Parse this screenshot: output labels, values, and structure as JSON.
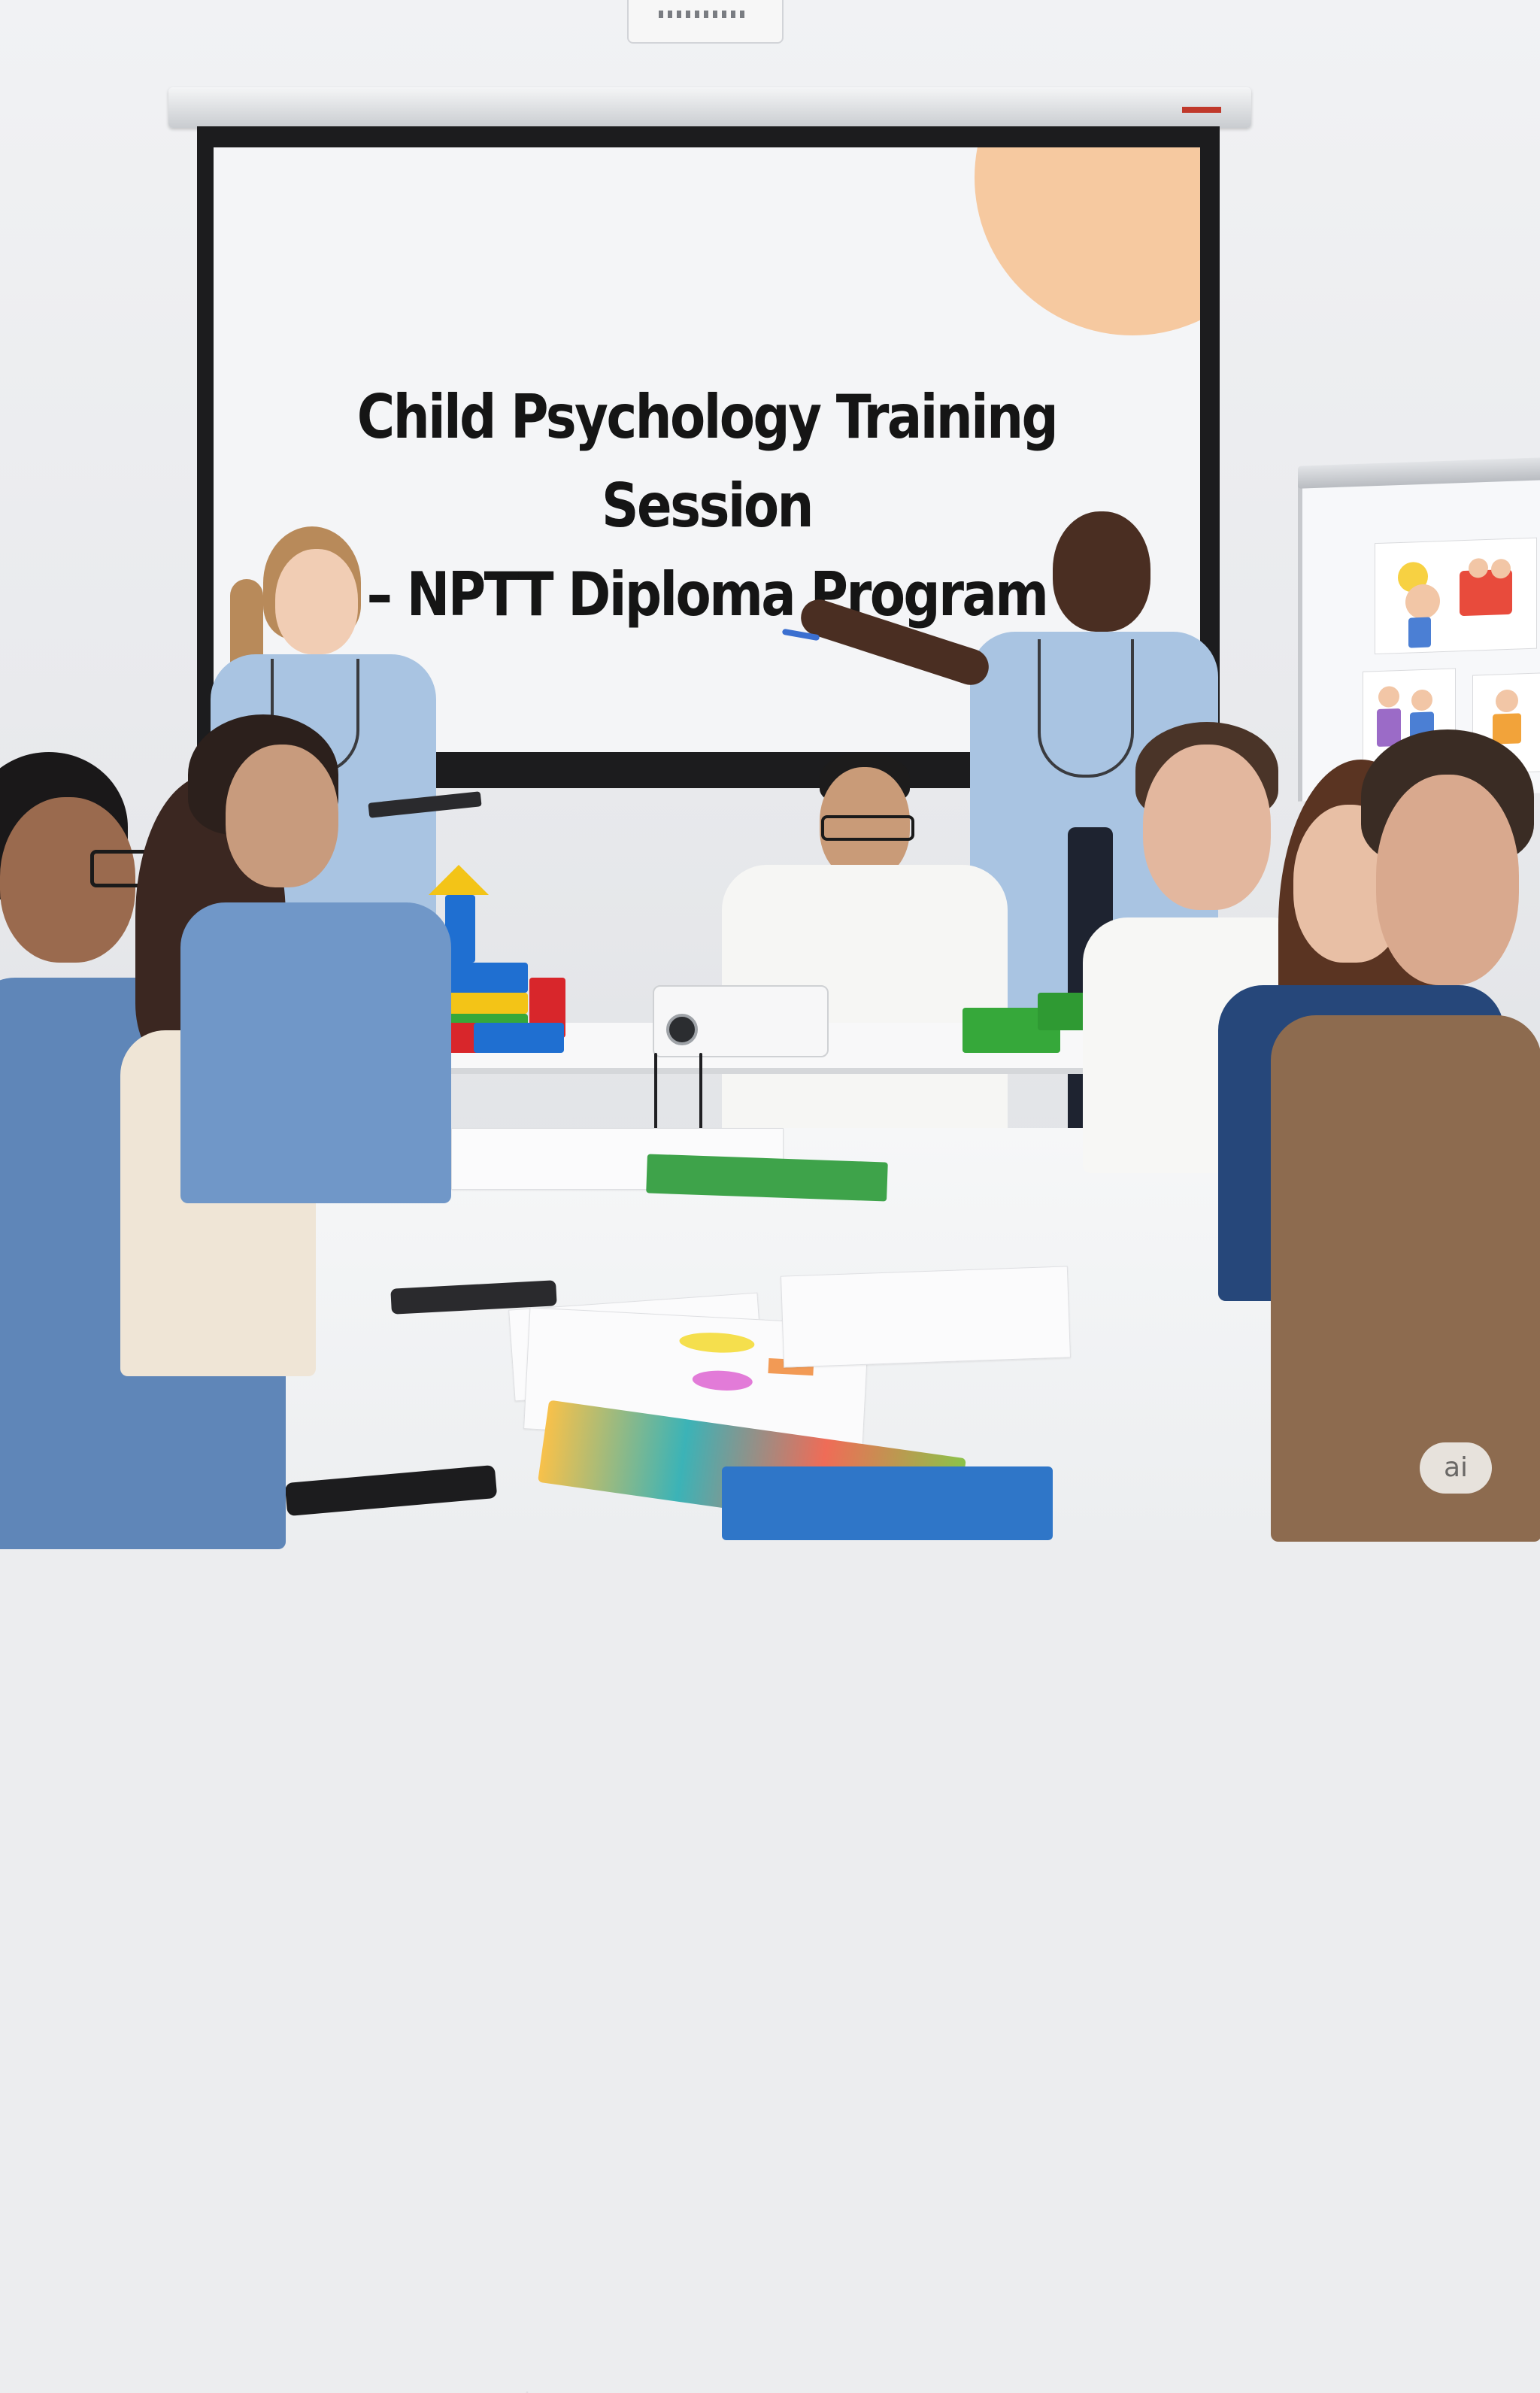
{
  "slide": {
    "title_line1": "Child Psychology Training Session",
    "title_line2": "– NPTT Diploma Program",
    "accent_color": "#f6c9a0"
  },
  "badge": {
    "label": "ai"
  },
  "palette": {
    "scrubs": "#a9c4e2",
    "wall": "#ecedef",
    "screen_frame": "#1c1c1e",
    "lego_red": "#d8262b",
    "lego_blue": "#1f6fd1",
    "lego_yellow": "#f3c417",
    "lego_green": "#36a83a"
  }
}
